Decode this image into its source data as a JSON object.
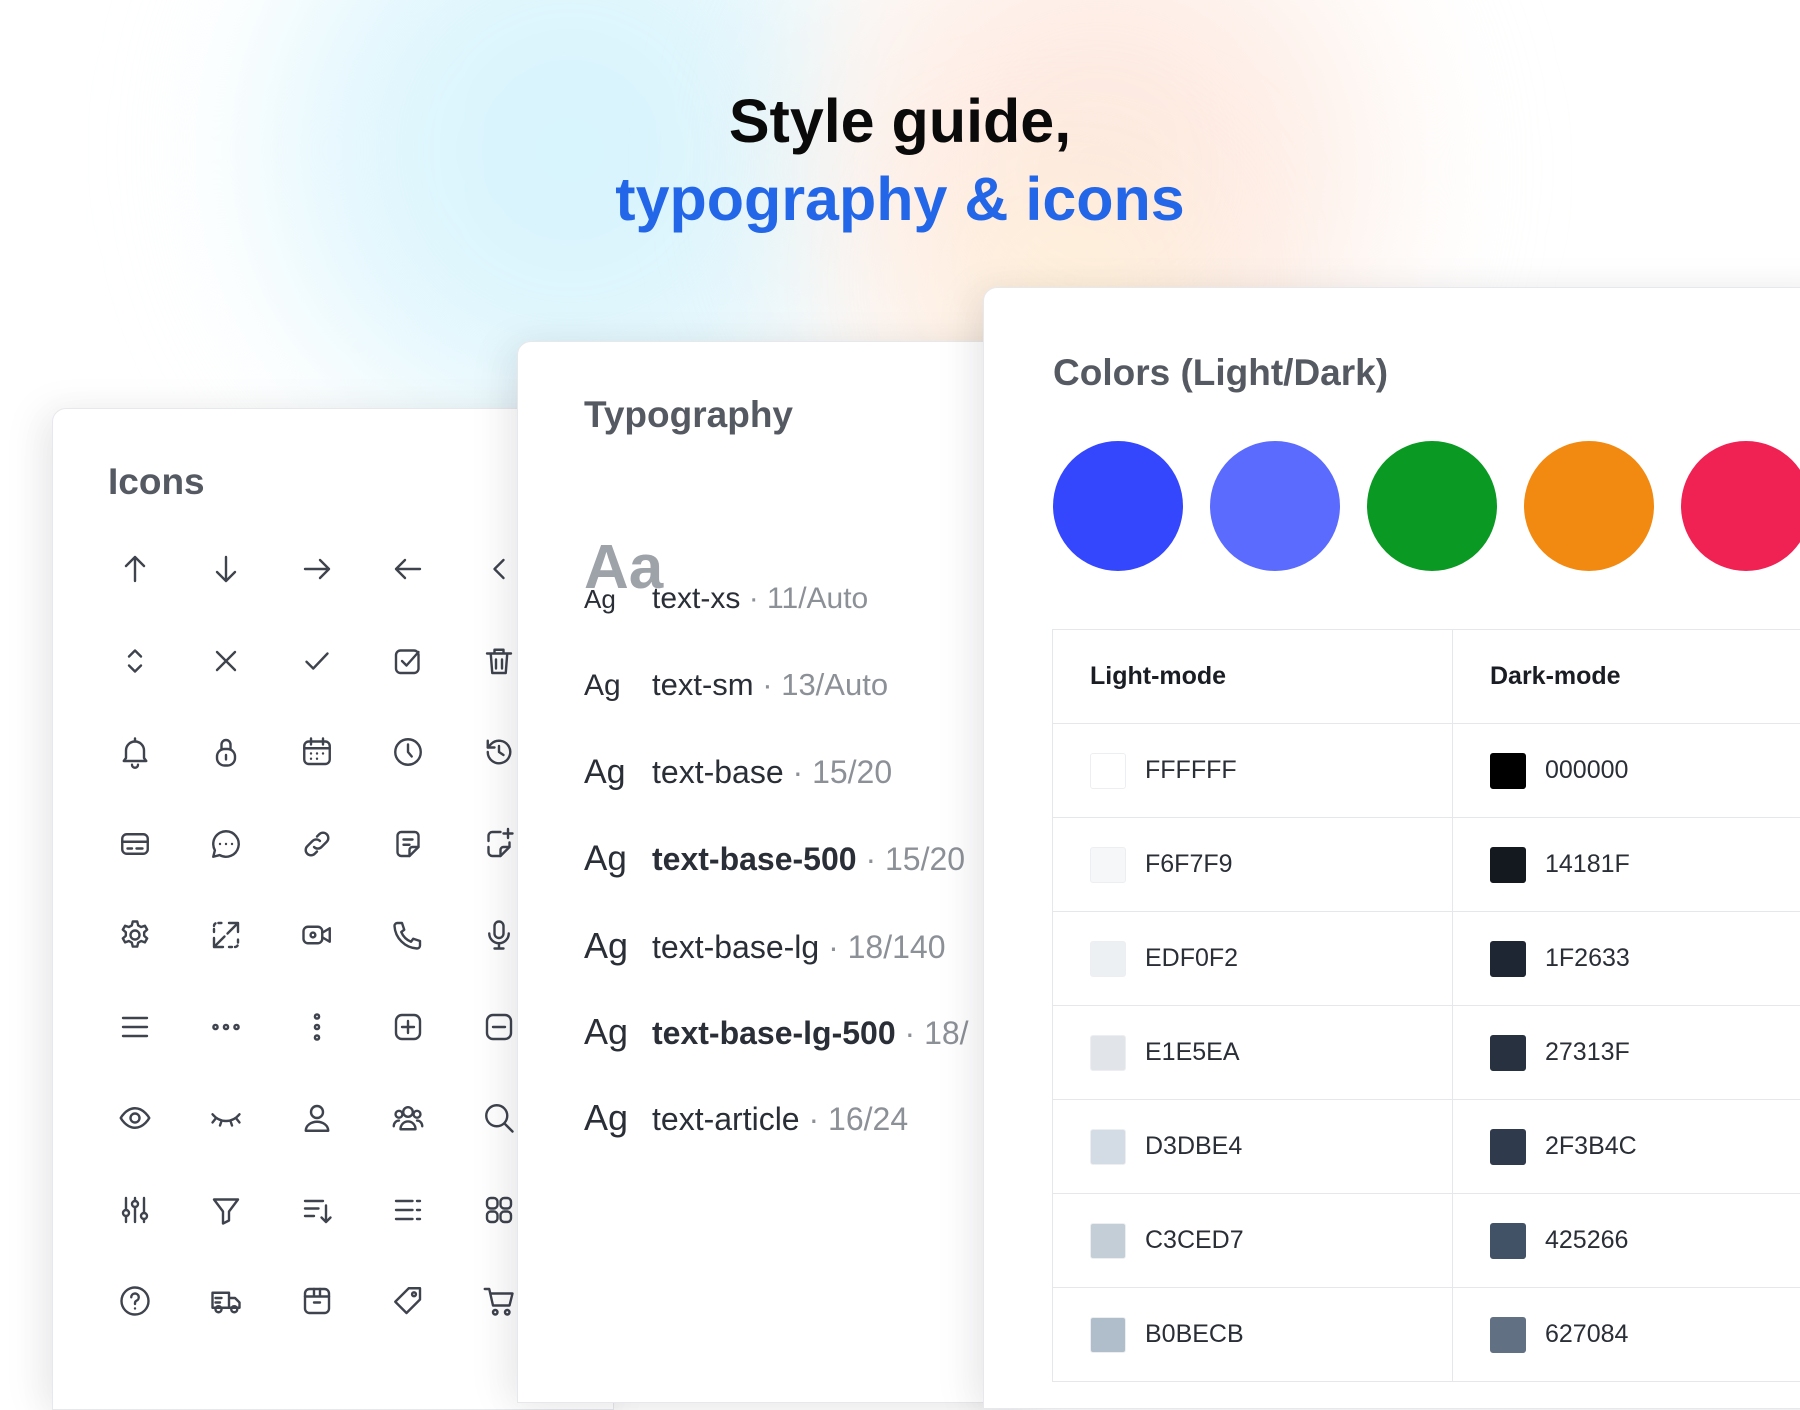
{
  "hero": {
    "line1": "Style guide,",
    "line2": "typography & icons"
  },
  "icons_panel": {
    "title": "Icons",
    "icons": [
      "arrow-up-icon",
      "arrow-down-icon",
      "arrow-right-icon",
      "arrow-left-icon",
      "chevron-left-icon",
      "chevron-up-down-icon",
      "close-icon",
      "check-icon",
      "checkbox-icon",
      "trash-icon",
      "bell-icon",
      "lock-icon",
      "calendar-icon",
      "clock-icon",
      "history-icon",
      "credit-card-icon",
      "chat-icon",
      "link-icon",
      "note-icon",
      "add-note-icon",
      "gear-icon",
      "expand-icon",
      "video-icon",
      "phone-icon",
      "microphone-icon",
      "menu-icon",
      "more-horizontal-icon",
      "more-vertical-icon",
      "plus-square-icon",
      "minus-square-icon",
      "eye-icon",
      "eye-closed-icon",
      "user-icon",
      "users-icon",
      "search-icon",
      "sliders-icon",
      "filter-icon",
      "sort-icon",
      "list-icon",
      "grid-icon",
      "help-icon",
      "truck-icon",
      "box-icon",
      "tag-icon",
      "cart-icon"
    ]
  },
  "typography_panel": {
    "title": "Typography",
    "sample": "Aa",
    "rows": [
      {
        "ag": "Ag",
        "name": "text-xs",
        "meta": "11/Auto"
      },
      {
        "ag": "Ag",
        "name": "text-sm",
        "meta": "13/Auto"
      },
      {
        "ag": "Ag",
        "name": "text-base",
        "meta": "15/20"
      },
      {
        "ag": "Ag",
        "name": "text-base-500",
        "meta": "15/20"
      },
      {
        "ag": "Ag",
        "name": "text-base-lg",
        "meta": "18/140"
      },
      {
        "ag": "Ag",
        "name": "text-base-lg-500",
        "meta": "18/"
      },
      {
        "ag": "Ag",
        "name": "text-article",
        "meta": "16/24"
      }
    ],
    "separator": "·"
  },
  "colors_panel": {
    "title": "Colors (Light/Dark)",
    "swatches": [
      "#3447fd",
      "#5b6bfd",
      "#0a9a23",
      "#f28a12",
      "#f02254"
    ],
    "table": {
      "headers": [
        "Light-mode",
        "Dark-mode"
      ],
      "rows": [
        {
          "light": "FFFFFF",
          "dark": "000000"
        },
        {
          "light": "F6F7F9",
          "dark": "14181F"
        },
        {
          "light": "EDF0F2",
          "dark": "1F2633"
        },
        {
          "light": "E1E5EA",
          "dark": "27313F"
        },
        {
          "light": "D3DBE4",
          "dark": "2F3B4C"
        },
        {
          "light": "C3CED7",
          "dark": "425266"
        },
        {
          "light": "B0BECB",
          "dark": "627084"
        }
      ]
    }
  }
}
